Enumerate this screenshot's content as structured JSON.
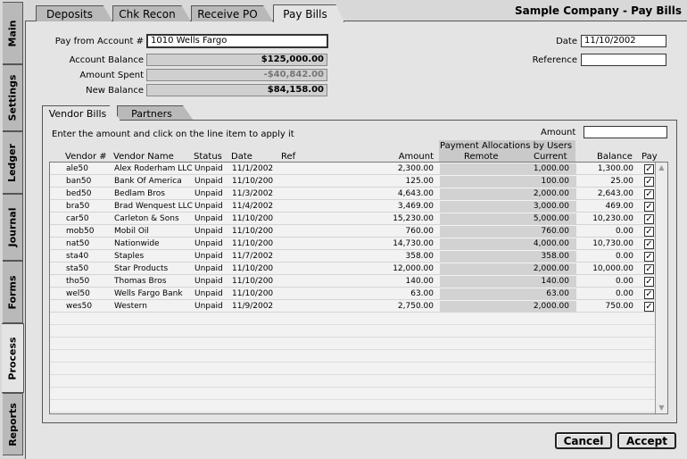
{
  "company_title": "Sample Company - Pay Bills",
  "side_tabs": [
    "Main",
    "Settings",
    "Ledger",
    "Journal",
    "Forms",
    "Process",
    "Reports"
  ],
  "top_tabs": [
    "Deposits",
    "Chk Recon",
    "Receive PO",
    "Pay Bills"
  ],
  "form": {
    "pay_from_label": "Pay from Account #",
    "pay_from_value": "1010 Wells Fargo",
    "account_balance_label": "Account Balance",
    "account_balance_value": "$125,000.00",
    "amount_spent_label": "Amount Spent",
    "amount_spent_value": "-$40,842.00",
    "new_balance_label": "New Balance",
    "new_balance_value": "$84,158.00",
    "date_label": "Date",
    "date_value": "11/10/2002",
    "reference_label": "Reference",
    "reference_value": ""
  },
  "sub_tabs": [
    "Vendor Bills",
    "Partners"
  ],
  "grid": {
    "instruction": "Enter the amount and click on the line item to apply it",
    "amount_label": "Amount",
    "amount_value": "",
    "alloc_header": "Payment Allocations by Users",
    "headers": {
      "vendor": "Vendor #",
      "name": "Vendor Name",
      "status": "Status",
      "date": "Date",
      "ref": "Ref",
      "amount": "Amount",
      "remote": "Remote",
      "current": "Current",
      "balance": "Balance",
      "pay": "Pay"
    },
    "rows": [
      {
        "vendor": "ale50",
        "name": "Alex Roderham LLC",
        "status": "Unpaid",
        "date": "11/1/2002",
        "ref": "",
        "amount": "2,300.00",
        "remote": "",
        "current": "1,000.00",
        "balance": "1,300.00",
        "pay": true
      },
      {
        "vendor": "ban50",
        "name": "Bank Of America",
        "status": "Unpaid",
        "date": "11/10/200",
        "ref": "",
        "amount": "125.00",
        "remote": "",
        "current": "100.00",
        "balance": "25.00",
        "pay": true
      },
      {
        "vendor": "bed50",
        "name": "Bedlam Bros",
        "status": "Unpaid",
        "date": "11/3/2002",
        "ref": "",
        "amount": "4,643.00",
        "remote": "",
        "current": "2,000.00",
        "balance": "2,643.00",
        "pay": true
      },
      {
        "vendor": "bra50",
        "name": "Brad Wenquest LLC",
        "status": "Unpaid",
        "date": "11/4/2002",
        "ref": "",
        "amount": "3,469.00",
        "remote": "",
        "current": "3,000.00",
        "balance": "469.00",
        "pay": true
      },
      {
        "vendor": "car50",
        "name": "Carleton & Sons",
        "status": "Unpaid",
        "date": "11/10/200",
        "ref": "",
        "amount": "15,230.00",
        "remote": "",
        "current": "5,000.00",
        "balance": "10,230.00",
        "pay": true
      },
      {
        "vendor": "mob50",
        "name": "Mobil Oil",
        "status": "Unpaid",
        "date": "11/10/200",
        "ref": "",
        "amount": "760.00",
        "remote": "",
        "current": "760.00",
        "balance": "0.00",
        "pay": true
      },
      {
        "vendor": "nat50",
        "name": "Nationwide",
        "status": "Unpaid",
        "date": "11/10/200",
        "ref": "",
        "amount": "14,730.00",
        "remote": "",
        "current": "4,000.00",
        "balance": "10,730.00",
        "pay": true
      },
      {
        "vendor": "sta40",
        "name": "Staples",
        "status": "Unpaid",
        "date": "11/7/2002",
        "ref": "",
        "amount": "358.00",
        "remote": "",
        "current": "358.00",
        "balance": "0.00",
        "pay": true
      },
      {
        "vendor": "sta50",
        "name": "Star Products",
        "status": "Unpaid",
        "date": "11/10/200",
        "ref": "",
        "amount": "12,000.00",
        "remote": "",
        "current": "2,000.00",
        "balance": "10,000.00",
        "pay": true
      },
      {
        "vendor": "tho50",
        "name": "Thomas Bros",
        "status": "Unpaid",
        "date": "11/10/200",
        "ref": "",
        "amount": "140.00",
        "remote": "",
        "current": "140.00",
        "balance": "0.00",
        "pay": true
      },
      {
        "vendor": "wel50",
        "name": "Wells Fargo Bank",
        "status": "Unpaid",
        "date": "11/10/200",
        "ref": "",
        "amount": "63.00",
        "remote": "",
        "current": "63.00",
        "balance": "0.00",
        "pay": true
      },
      {
        "vendor": "wes50",
        "name": "Western",
        "status": "Unpaid",
        "date": "11/9/2002",
        "ref": "",
        "amount": "2,750.00",
        "remote": "",
        "current": "2,000.00",
        "balance": "750.00",
        "pay": true
      }
    ]
  },
  "buttons": {
    "cancel": "Cancel",
    "accept": "Accept"
  }
}
